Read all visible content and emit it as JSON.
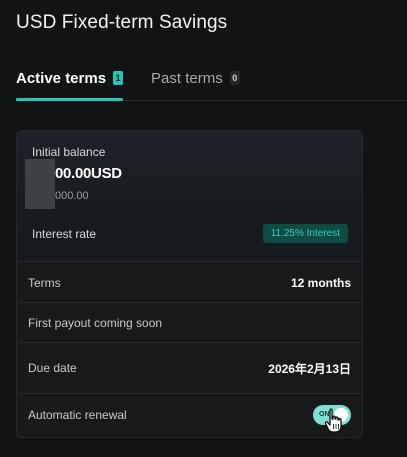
{
  "page": {
    "title": "USD Fixed-term Savings"
  },
  "tabs": [
    {
      "label": "Active terms",
      "count": "1",
      "active": true
    },
    {
      "label": "Past terms",
      "count": "0",
      "active": false
    }
  ],
  "card": {
    "initial_balance_label": "Initial balance",
    "amount": "00.00",
    "currency": "USD",
    "amount_sub": "000.00",
    "interest_label": "Interest rate",
    "interest_pill": "11.25% Interest",
    "rows": [
      {
        "label": "Terms",
        "value": "12 months"
      },
      {
        "label": "First payout coming soon",
        "value": ""
      },
      {
        "label": "Due date",
        "value": "2026年2月13日"
      }
    ],
    "auto_renewal": {
      "label": "Automatic renewal",
      "state": "ON"
    }
  },
  "colors": {
    "accent": "#20c9b0",
    "background": "#121315",
    "toggle_on": "#7ee0d1"
  },
  "icons": {
    "cursor": "hand-pointer-icon"
  }
}
